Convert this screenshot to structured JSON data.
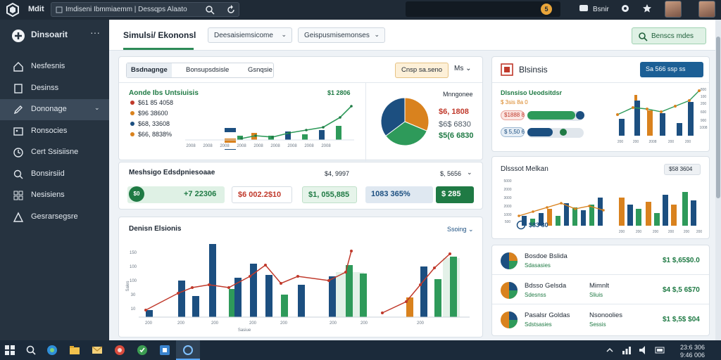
{
  "topbar": {
    "app_name": "Mdit",
    "url_text": "Imdiseni Ibmmiaemm | Dessqps Alaato",
    "notification_count": "5",
    "share_label": "Bsnir"
  },
  "sidebar": {
    "brand": "Dinsoarit",
    "items": [
      {
        "label": "Nesfesnis",
        "icon": "home-icon"
      },
      {
        "label": "Desinss",
        "icon": "document-icon"
      },
      {
        "label": "Dononage",
        "icon": "pen-icon",
        "active": true
      },
      {
        "label": "Ronsocies",
        "icon": "image-icon"
      },
      {
        "label": "Cert Ssisiisne",
        "icon": "clock-icon"
      },
      {
        "label": "Bonsirsiid",
        "icon": "search-icon"
      },
      {
        "label": "Nesisiens",
        "icon": "grid-icon"
      },
      {
        "label": "Gesrarsegsre",
        "icon": "warning-icon"
      }
    ]
  },
  "tabheader": {
    "title": "Simulsi/ Ekononsl",
    "dropdown1": "Deesaisiemsicome",
    "dropdown2": "Geispusmisemonses",
    "action_button": "Benscs mdes"
  },
  "overview": {
    "tabs": [
      "Bsdnagnge",
      "Bonsupsdsisle",
      "Gsnqsie"
    ],
    "period_select": "Cnsp sa.seno",
    "ctrl_label": "Ms",
    "chart_title": "Aonde Ibs Untsiuisis",
    "chart_value": "$1 2806",
    "legend": [
      {
        "label": "$61 85 4058",
        "color": "#c0392b"
      },
      {
        "label": "$96 38600",
        "color": "#d9821e"
      },
      {
        "label": "$68, 33608",
        "color": "#1c4f80"
      },
      {
        "label": "$66, 8838%",
        "color": "#d9821e"
      }
    ],
    "pie_title": "Mnngonee",
    "pie_values": [
      "$6, 1808",
      "$6$ 6830",
      "$5(6 6830"
    ],
    "x_ticks": [
      "2008",
      "2008",
      "2008",
      "2008",
      "2008",
      "2008",
      "2008",
      "2008",
      "2008"
    ]
  },
  "summary": {
    "title": "Meshsigo Edsdpniesoaae",
    "value1": "$4, 9997",
    "value2": "$, 5656",
    "chips": [
      {
        "label": "+7 22306"
      },
      {
        "label": "$6 002.2$10"
      },
      {
        "label": "$1, 055,885"
      },
      {
        "label": "1083 365%"
      },
      {
        "label": "$ 285"
      }
    ],
    "chip_badge": "$0"
  },
  "main_chart": {
    "title": "Denisn Elsionis",
    "control": "Ssoing",
    "y_ticks": [
      "150",
      "100",
      "100",
      "30",
      "10"
    ],
    "y_label": "Sales",
    "x_ticks": [
      "200",
      "200",
      "200",
      "200",
      "200",
      "200",
      "200",
      "200"
    ],
    "x_label": "Sasiue"
  },
  "right_top": {
    "title": "Blsinsis",
    "button": "Sa 566 ssp ss",
    "subtitle": "Dlsnsiso Ueodsitdsr",
    "sub_value": "$ 3sis 8a 0",
    "progress_label_1": "$1888 8",
    "progress_label_2": "$ 5,50 6",
    "progress_1_fraction": 0.85,
    "progress_2_fraction": 0.45,
    "x_ticks": [
      "200",
      "200",
      "2008",
      "200",
      "200"
    ],
    "y_ticks": [
      "800",
      "100",
      "200",
      "600",
      "900",
      "1008"
    ]
  },
  "right_mid": {
    "title": "Dlsssot Melkan",
    "badge": "$58 3604",
    "foot_value": "$83 80",
    "y_ticks": [
      "5000",
      "2000",
      "3000",
      "2000",
      "1000",
      "500"
    ],
    "x_ticks": [
      "200",
      "200",
      "200",
      "200",
      "200",
      "200"
    ]
  },
  "right_list": [
    {
      "title": "Bosdoe Bslida",
      "sub": "Sdasasies",
      "value": "$1 $,65$0.0",
      "mid_title": "",
      "mid_sub": ""
    },
    {
      "title": "Bdsso Gelsda",
      "sub": "Sdesnss",
      "value": "$4 $,5 6$70",
      "mid_title": "Mimnlt",
      "mid_sub": "Sliuis"
    },
    {
      "title": "Pasalsr Goldas",
      "sub": "Sdstsasies",
      "value": "$1 $,5$ $04",
      "mid_title": "Nsonoolies",
      "mid_sub": "Sessis"
    }
  ],
  "taskbar": {
    "time": "23:6 306",
    "date": "9:46 006"
  }
}
